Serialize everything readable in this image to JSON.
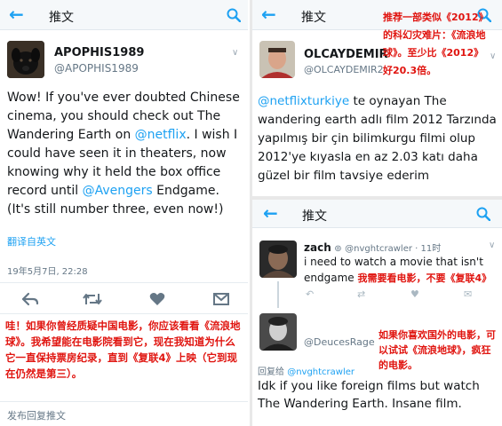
{
  "left": {
    "header": {
      "title": "推文"
    },
    "tweet": {
      "display_name": "APOPHIS1989",
      "handle": "@APOPHIS1989",
      "body_1": "Wow! If you've ever doubted Chinese cinema, you should check out The Wandering Earth on ",
      "mention_netflix": "@netflix",
      "body_2": ". I wish I could have seen it in theaters, now knowing why it held the box office record until ",
      "mention_avengers": "@Avengers",
      "body_3": " Endgame. (It's still number three, even now!)",
      "translate": "翻译自英文",
      "timestamp": "19年5月7日, 22:28"
    },
    "translation_note": "哇！如果你曾经质疑中国电影，你应该看看《流浪地球》。我希望能在电影院看到它，现在我知道为什么它一直保持票房纪录，直到《复联4》上映（它到现在仍然是第三）。",
    "reply_bar": "发布回复推文"
  },
  "right_top": {
    "header": {
      "title": "推文"
    },
    "tweet": {
      "display_name": "OLCAYDEMIR",
      "handle": "@OLCAYDEMIR2",
      "mention": "@netflixturkiye",
      "body": " te oynayan The wandering earth  adlı film 2012 Tarzında yapılmış bir çin bilimkurgu filmi olup 2012'ye kıyasla en az 2.03 katı daha güzel bir film tavsiye ederim"
    },
    "translation_note": "推荐一部类似《2012》的科幻灾难片：《流浪地球》。至少比《2012》好20.3倍。"
  },
  "right_bottom": {
    "header": {
      "title": "推文"
    },
    "tweet1": {
      "display_name": "zach",
      "handle": "@nvghtcrawler · 11时",
      "body_1": "i need to watch a movie that isn't",
      "body_2": "endgame",
      "translation_note": "我需要看电影，不要《复联4》"
    },
    "tweet2": {
      "handle": "@DeucesRage",
      "reply_to_label": "回复给",
      "reply_to_handle": "@nvghtcrawler",
      "body": "Idk if you like foreign films but watch The Wandering Earth. Insane film.",
      "translation_note": "如果你喜欢国外的电影，可以试试《流浪地球》，疯狂的电影。"
    }
  }
}
